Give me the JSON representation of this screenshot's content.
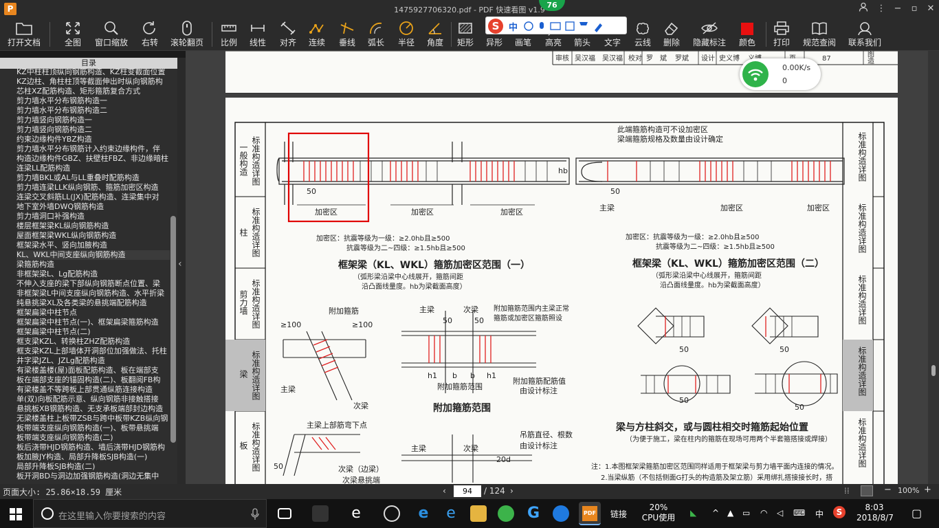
{
  "app": {
    "logo": "P",
    "title": "1475927706320.pdf - PDF 快速看图 v1.9"
  },
  "toolbar": {
    "items": [
      {
        "label": "打开文档",
        "icon": "folder-icon"
      },
      {
        "label": "全图",
        "icon": "fit-all-icon"
      },
      {
        "label": "窗口缩放",
        "icon": "zoom-icon"
      },
      {
        "label": "右转",
        "icon": "rotate-right-icon"
      },
      {
        "label": "滚轮翻页",
        "icon": "mouse-icon"
      },
      {
        "label": "比例",
        "icon": "ruler-icon"
      },
      {
        "label": "线性",
        "icon": "linear-measure-icon"
      },
      {
        "label": "对齐",
        "icon": "align-measure-icon"
      },
      {
        "label": "连续",
        "icon": "continuous-measure-icon"
      },
      {
        "label": "垂线",
        "icon": "perpendicular-icon"
      },
      {
        "label": "弧长",
        "icon": "arc-length-icon"
      },
      {
        "label": "半径",
        "icon": "radius-icon"
      },
      {
        "label": "角度",
        "icon": "angle-icon"
      },
      {
        "label": "矩形",
        "icon": "rectangle-icon"
      },
      {
        "label": "异形",
        "icon": "polygon-icon"
      },
      {
        "label": "画笔",
        "icon": "pen-icon"
      },
      {
        "label": "高亮",
        "icon": "highlight-icon"
      },
      {
        "label": "箭头",
        "icon": "arrow-icon"
      },
      {
        "label": "文字",
        "icon": "text-icon"
      },
      {
        "label": "云线",
        "icon": "cloud-line-icon"
      },
      {
        "label": "删除",
        "icon": "eraser-icon"
      },
      {
        "label": "隐藏标注",
        "icon": "hide-eye-icon"
      },
      {
        "label": "颜色",
        "icon": "color-swatch-icon"
      },
      {
        "label": "打印",
        "icon": "printer-icon"
      },
      {
        "label": "规范查阅",
        "icon": "book-icon"
      },
      {
        "label": "联系我们",
        "icon": "support-icon"
      }
    ],
    "color_swatch": "#e81010"
  },
  "badge": "76",
  "ime": {
    "logo": "S",
    "mode": "中"
  },
  "network": {
    "speed": "0.00K/s",
    "count": "0"
  },
  "toc": {
    "heading": "目录",
    "items": [
      "KZ中柱柱顶纵向钢筋构造、KZ柱变截面位置",
      "KZ边柱、角柱柱顶等截面伸出时纵向钢筋构",
      "芯柱XZ配筋构造、矩形箍筋复合方式",
      "剪力墙水平分布钢筋构造一",
      "剪力墙水平分布钢筋构造二",
      "剪力墙竖向钢筋构造一",
      "剪力墙竖向钢筋构造二",
      "约束边缘构件YBZ构造",
      "剪力墙水平分布钢筋计入约束边缘构件，伴",
      "构造边缘构件GBZ、扶壁柱FBZ、非边缘暗柱",
      "连梁LL配筋构造",
      "剪力墙BKL或AL与LL重叠时配筋构造",
      "剪力墙连梁LLK纵向钢筋、箍筋加密区构造",
      "连梁交叉斜筋LL(JX)配筋构造、连梁集中对",
      "地下室外墙DWQ钢筋构造",
      "剪力墙洞口补强构造",
      "楼层框架梁KL纵向钢筋构造",
      "屋面框架梁WKL纵向钢筋构造",
      "框架梁水平、竖向加腋构造",
      "KL、WKL中间支座纵向钢筋构造",
      "梁箍筋构造",
      "非框架梁L、Lg配筋构造",
      "不伸入支座的梁下部纵向钢筋断点位置、梁",
      "非框架梁L中间支座纵向钢筋构造、水平折梁",
      "纯悬挑梁XL及各类梁的悬挑端配筋构造",
      "框架扁梁中柱节点",
      "框架扁梁中柱节点(一)、框架扁梁箍筋构造",
      "框架扁梁中柱节点(二)",
      "框支梁KZL、转换柱ZHZ配筋构造",
      "框支梁KZL上部墙体开洞部位加强做法、托柱",
      "井字梁JZL、JZLg配筋构造",
      "有梁楼盖楼(屋)面板配筋构造、板在端部支",
      "板在端部支座的锚固构造(二)、板翻阅FB构",
      "有梁楼盖不等跨板上部贯通纵筋连接构造",
      "单(双)向板配筋示意、纵向钢筋非接触搭接",
      "悬挑板XB钢筋构造、无支承板端部封边构造",
      "无梁楼盖柱上板带ZSB与跨中板带KZB纵向钢",
      "板带端支座纵向钢筋构造(一)、板带悬挑端",
      "板带端支座纵向钢筋构造(二)",
      "板后浇带HJD钢筋构造、墙后浇带HJD钢筋构",
      "板加腋JY构造、局部升降板SJB构造(一)",
      "局部升降板SJB构造(二)",
      "板开洞BD与洞边加强钢筋构造(洞边无集中"
    ],
    "active_index": 19
  },
  "drawing": {
    "top_strip": [
      "审核",
      "吴汉福",
      "吴汉福",
      "校对",
      "罗",
      "斌",
      "罗斌",
      "设计",
      "史义博",
      "义博",
      "页",
      "87",
      "图",
      "造"
    ],
    "left_tabs": [
      "标准构造详图",
      "柱",
      "剪力墙",
      "梁",
      "板"
    ],
    "left_headings": [
      "一般构造",
      "柱",
      "剪力墙",
      "梁",
      "板"
    ],
    "right_tabs": [
      "标准构造详图",
      "标准构造详图",
      "标准构造详图",
      "标准构造详图",
      "标准构造详图"
    ],
    "dense_zone": "加密区",
    "note_dense1": "加密区：抗震等级为一级：≥2.0hb且≥500",
    "note_dense2": "抗震等级为二~四级：≥1.5hb且≥500",
    "title1": "框架梁（KL、WKL）箍筋加密区范围（一）",
    "title2": "框架梁（KL、WKL）箍筋加密区范围（二）",
    "sub1a": "（弧形梁沿梁中心线展开，箍筋间距",
    "sub1b": "沿凸面线量度。hb为梁截面高度）",
    "end_note1": "此端箍筋构造可不设加密区",
    "end_note2": "梁端箍筋规格及数量由设计确定",
    "main_beam": "主梁",
    "sec_beam": "次梁",
    "sec_beam_edge": "次梁（边梁）",
    "add_stirrup": "附加箍筋",
    "add_note1": "附加箍筋范围内主梁正常",
    "add_note2": "箍筋或加密区箍筋照设",
    "add_range_label": "附加箍筋范围",
    "add_value1": "附加箍筋配筋值",
    "add_value2": "由设计标注",
    "title_add": "附加箍筋范围",
    "main_top_bend": "主梁上部筋弯下点",
    "hanger1": "吊筋直径、根数",
    "hanger2": "由设计标注",
    "title_col": "梁与方柱斜交，或与圆柱相交时箍筋起始位置",
    "sub_col": "（为便于施工，梁在柱内的箍筋在现场可用两个半套箍搭接或焊接）",
    "note1": "注：1.本图框架梁箍筋加密区范围同样适用于框架梁与剪力墙平面内连接的情况。",
    "note2": "2.当梁纵筋（不包括侧面G打头的构造筋及架立筋）采用绑扎搭接接长时，搭",
    "d50": "50",
    "d100": "≥100",
    "d20d": "20d",
    "hb": "hb",
    "b": "b",
    "h1": "h1",
    "cantilever": "次梁悬挑端"
  },
  "status": {
    "page_size": "页面大小: 25.86×18.59 厘米",
    "page_current": "94",
    "page_total": "/ 124",
    "zoom": "100%"
  },
  "taskbar": {
    "search_placeholder": "在这里输入你要搜索的内容",
    "link_label": "链接",
    "cpu_value": "20%",
    "cpu_label": "CPU使用",
    "ime": "中",
    "time": "8:03",
    "date": "2018/8/7"
  }
}
